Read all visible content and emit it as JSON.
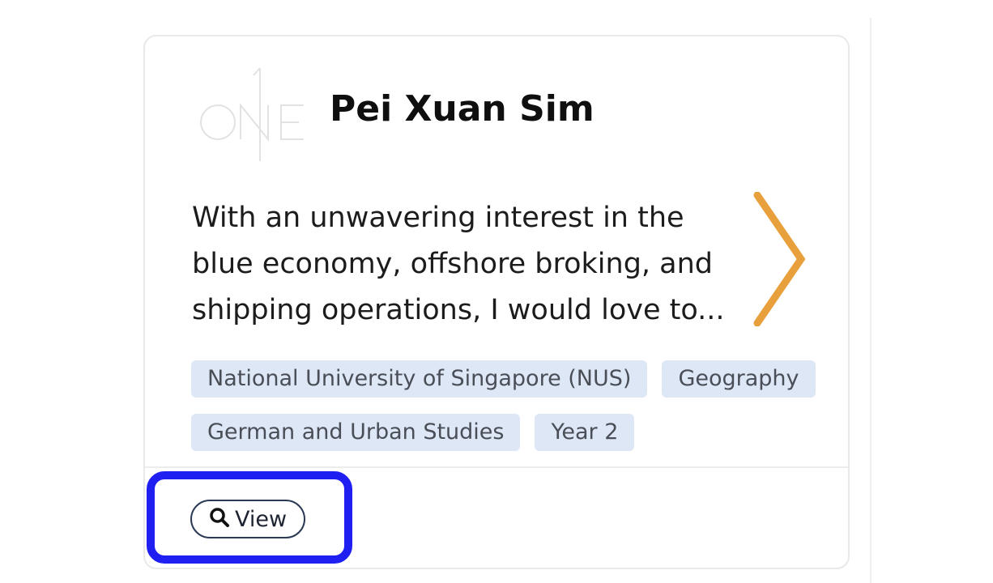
{
  "profile": {
    "logo_icon": "one-logo-icon",
    "name": "Pei Xuan Sim",
    "bio": "With an unwavering interest in the blue economy, offshore broking, and shipping operations, I would love to...",
    "next_icon": "chevron-right-icon",
    "accent_color": "#e8a03c",
    "tags": [
      "National University of Singapore (NUS)",
      "Geography",
      "German and Urban Studies",
      "Year 2"
    ]
  },
  "actions": {
    "view_icon": "search-icon",
    "view_label": "View"
  },
  "highlight": {
    "color": "#1f1ff2"
  }
}
